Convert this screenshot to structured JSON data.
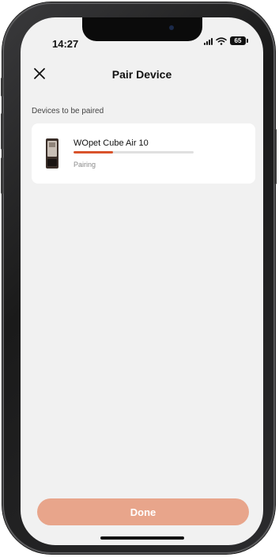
{
  "status_bar": {
    "time": "14:27",
    "battery": "65"
  },
  "header": {
    "title": "Pair Device"
  },
  "section": {
    "label": "Devices to be paired"
  },
  "devices": [
    {
      "name": "WOpet Cube Air 10",
      "status": "Pairing",
      "progress": 0.33
    }
  ],
  "footer": {
    "done_label": "Done"
  },
  "colors": {
    "accent": "#d9532b",
    "button": "#e8a58b",
    "background": "#f1f1f1"
  }
}
